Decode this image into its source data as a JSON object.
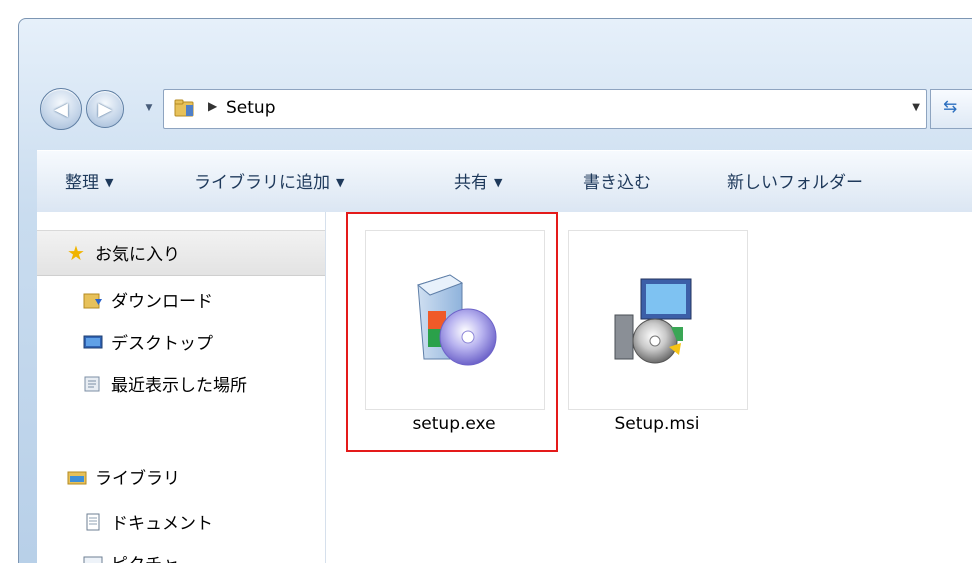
{
  "address_bar": {
    "path": "Setup"
  },
  "toolbar": {
    "organize": "整理",
    "add_to_library": "ライブラリに追加",
    "share": "共有",
    "burn": "書き込む",
    "new_folder": "新しいフォルダー"
  },
  "nav_pane": {
    "favorites": "お気に入り",
    "favorite_items": [
      "ダウンロード",
      "デスクトップ",
      "最近表示した場所"
    ],
    "libraries": "ライブラリ",
    "library_items": [
      "ドキュメント",
      "ピクチャ"
    ]
  },
  "files": [
    {
      "name": "setup.exe",
      "icon": "installer-box-cd-icon",
      "highlighted": true
    },
    {
      "name": "Setup.msi",
      "icon": "msi-computer-cd-icon",
      "highlighted": false
    }
  ],
  "colors": {
    "highlight": "#e41a1a",
    "window_frame": "#c9dcef",
    "toolbar_text": "#1e395b"
  }
}
